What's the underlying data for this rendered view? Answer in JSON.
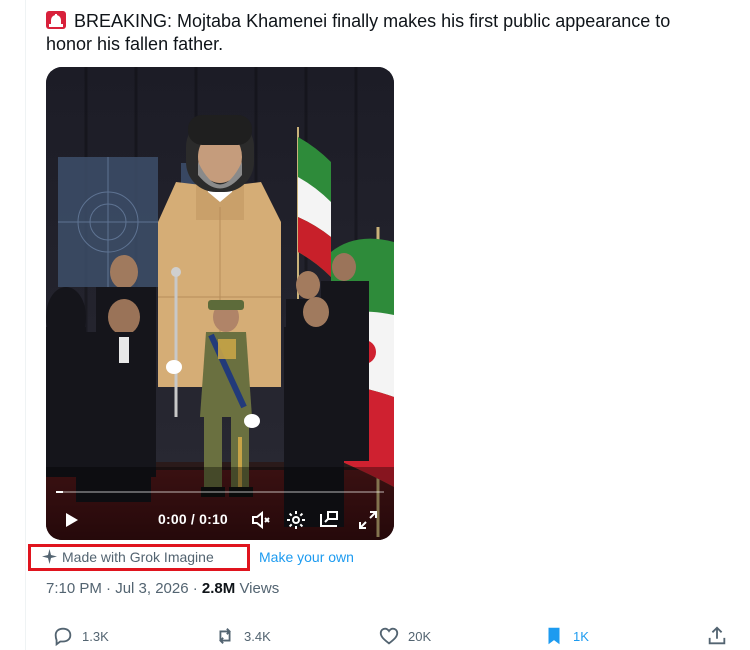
{
  "tweet": {
    "text": "BREAKING: Mojtaba Khamenei finally makes his first public appearance to honor his fallen father.",
    "siren_icon": "police-siren-icon"
  },
  "video": {
    "time_display": "0:00 / 0:10",
    "progress": 0.02,
    "controls": [
      "play-icon",
      "volume-icon",
      "settings-icon",
      "pip-icon",
      "fullscreen-icon"
    ]
  },
  "grok": {
    "label": "Made with Grok Imagine",
    "link": "Make your own",
    "highlight_color": "#e0141e"
  },
  "meta": {
    "timestamp": "7:10 PM · Jul 3, 2026 · ",
    "views_count": "2.8M",
    "views_label": " Views"
  },
  "actions": {
    "replies": "1.3K",
    "reposts": "3.4K",
    "likes": "20K",
    "bookmarks": "1K"
  },
  "colors": {
    "accent": "#1d9bf0",
    "muted": "#536471",
    "text": "#0f1419"
  }
}
